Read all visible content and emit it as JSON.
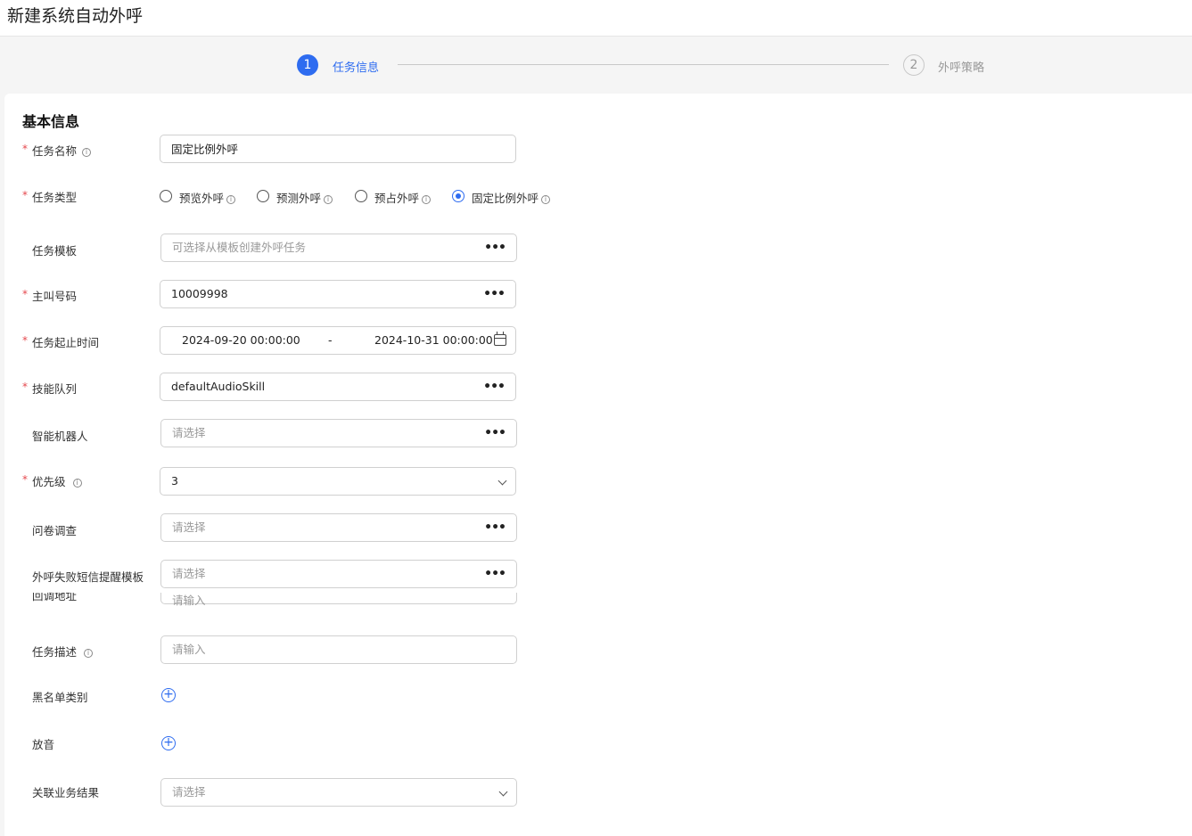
{
  "header": {
    "title": "新建系统自动外呼"
  },
  "steps": [
    {
      "number": "1",
      "label": "任务信息"
    },
    {
      "number": "2",
      "label": "外呼策略"
    }
  ],
  "section": {
    "title": "基本信息"
  },
  "info_glyph": "i",
  "required_mark": "*",
  "form": {
    "task_name": {
      "label": "任务名称",
      "value": "固定比例外呼"
    },
    "task_type": {
      "label": "任务类型",
      "options": [
        "预览外呼",
        "预测外呼",
        "预占外呼",
        "固定比例外呼"
      ],
      "selected": "固定比例外呼"
    },
    "task_template": {
      "label": "任务模板",
      "placeholder": "可选择从模板创建外呼任务"
    },
    "caller_number": {
      "label": "主叫号码",
      "value": "10009998"
    },
    "task_time": {
      "label": "任务起止时间",
      "start": "2024-09-20 00:00:00",
      "separator": "-",
      "end": "2024-10-31 00:00:00"
    },
    "skill_queue": {
      "label": "技能队列",
      "value": "defaultAudioSkill"
    },
    "robot": {
      "label": "智能机器人",
      "placeholder": "请选择"
    },
    "priority": {
      "label": "优先级",
      "value": "3"
    },
    "survey": {
      "label": "问卷调查",
      "placeholder": "请选择"
    },
    "sms_template": {
      "label": "外呼失败短信提醒模板",
      "placeholder": "请选择"
    },
    "callback_url": {
      "label": "回调地址",
      "placeholder": "请输入"
    },
    "description": {
      "label": "任务描述",
      "placeholder": "请输入"
    },
    "blacklist": {
      "label": "黑名单类别"
    },
    "playback": {
      "label": "放音"
    },
    "business_result": {
      "label": "关联业务结果",
      "placeholder": "请选择"
    }
  },
  "icons": {
    "more": "more-dots-icon",
    "info": "info-circle-icon",
    "add": "plus-circle-icon",
    "calendar": "calendar-icon",
    "dropdown": "chevron-down-icon"
  },
  "colors": {
    "primary": "#2e6cf0",
    "required": "#e5484d"
  }
}
